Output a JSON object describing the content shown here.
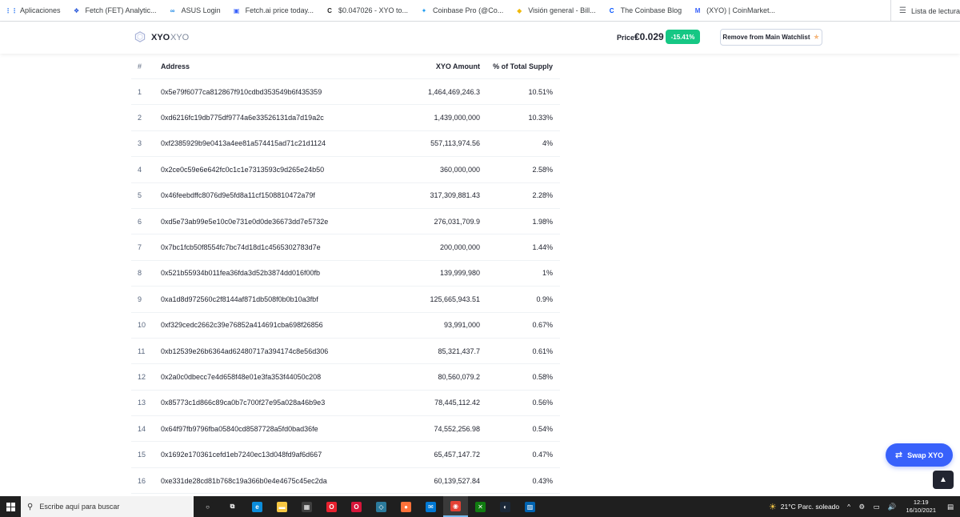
{
  "bookmarks": [
    {
      "label": "Aplicaciones",
      "icon": "apps-grid-icon",
      "color": "#4285f4"
    },
    {
      "label": "Fetch (FET) Analytic...",
      "icon": "fetch-icon",
      "color": "#1d4ed8"
    },
    {
      "label": "ASUS Login",
      "icon": "asus-icon",
      "color": "#1e88e5"
    },
    {
      "label": "Fetch.ai price today...",
      "icon": "coingecko-icon",
      "color": "#3861fb"
    },
    {
      "label": "$0.047026 - XYO to...",
      "icon": "c-icon",
      "color": "#222222"
    },
    {
      "label": "Coinbase Pro (@Co...",
      "icon": "twitter-icon",
      "color": "#1d9bf0"
    },
    {
      "label": "Visión general - Bill...",
      "icon": "binance-icon",
      "color": "#f0b90b"
    },
    {
      "label": "The Coinbase Blog",
      "icon": "coinbase-icon",
      "color": "#0052ff"
    },
    {
      "label": "(XYO) | CoinMarket...",
      "icon": "coinmarketcap-icon",
      "color": "#3861fb"
    }
  ],
  "reading_list": "Lista de lectura",
  "header": {
    "symbol": "XYO",
    "name": "XYO",
    "price_label": "Price:",
    "price_value": "€0.029",
    "change": "-15.41%",
    "watchlist_button": "Remove from Main Watchlist",
    "accent_green": "#16c784"
  },
  "table": {
    "columns": [
      "#",
      "Address",
      "XYO Amount",
      "% of Total Supply"
    ],
    "rows": [
      {
        "rank": "1",
        "address": "0x5e79f6077ca812867f910cdbd353549b6f435359",
        "amount": "1,464,469,246.3",
        "pct": "10.51%"
      },
      {
        "rank": "2",
        "address": "0xd6216fc19db775df9774a6e33526131da7d19a2c",
        "amount": "1,439,000,000",
        "pct": "10.33%"
      },
      {
        "rank": "3",
        "address": "0xf2385929b9e0413a4ee81a574415ad71c21d1124",
        "amount": "557,113,974.56",
        "pct": "4%"
      },
      {
        "rank": "4",
        "address": "0x2ce0c59e6e642fc0c1c1e7313593c9d265e24b50",
        "amount": "360,000,000",
        "pct": "2.58%"
      },
      {
        "rank": "5",
        "address": "0x46feebdffc8076d9e5fd8a11cf1508810472a79f",
        "amount": "317,309,881.43",
        "pct": "2.28%"
      },
      {
        "rank": "6",
        "address": "0xd5e73ab99e5e10c0e731e0d0de36673dd7e5732e",
        "amount": "276,031,709.9",
        "pct": "1.98%"
      },
      {
        "rank": "7",
        "address": "0x7bc1fcb50f8554fc7bc74d18d1c4565302783d7e",
        "amount": "200,000,000",
        "pct": "1.44%"
      },
      {
        "rank": "8",
        "address": "0x521b55934b011fea36fda3d52b3874dd016f00fb",
        "amount": "139,999,980",
        "pct": "1%"
      },
      {
        "rank": "9",
        "address": "0xa1d8d972560c2f8144af871db508f0b0b10a3fbf",
        "amount": "125,665,943.51",
        "pct": "0.9%"
      },
      {
        "rank": "10",
        "address": "0xf329cedc2662c39e76852a414691cba698f26856",
        "amount": "93,991,000",
        "pct": "0.67%"
      },
      {
        "rank": "11",
        "address": "0xb12539e26b6364ad62480717a394174c8e56d306",
        "amount": "85,321,437.7",
        "pct": "0.61%"
      },
      {
        "rank": "12",
        "address": "0x2a0c0dbecc7e4d658f48e01e3fa353f44050c208",
        "amount": "80,560,079.2",
        "pct": "0.58%"
      },
      {
        "rank": "13",
        "address": "0x85773c1d866c89ca0b7c700f27e95a028a46b9e3",
        "amount": "78,445,112.42",
        "pct": "0.56%"
      },
      {
        "rank": "14",
        "address": "0x64f97fb9796fba05840cd8587728a5fd0bad36fe",
        "amount": "74,552,256.98",
        "pct": "0.54%"
      },
      {
        "rank": "15",
        "address": "0x1692e170361cefd1eb7240ec13d048fd9af6d667",
        "amount": "65,457,147.72",
        "pct": "0.47%"
      },
      {
        "rank": "16",
        "address": "0xe331de28cd81b768c19a366b0e4e4675c45ec2da",
        "amount": "60,139,527.84",
        "pct": "0.43%"
      }
    ]
  },
  "swap_button": "Swap XYO",
  "taskbar": {
    "search_placeholder": "Escribe aquí para buscar",
    "weather": "21°C  Parc. soleado",
    "time": "12:19",
    "date": "16/10/2021",
    "apps": [
      {
        "icon": "cortana-icon",
        "color": "#1f1f1f"
      },
      {
        "icon": "task-view-icon",
        "color": "#1f1f1f"
      },
      {
        "icon": "edge-icon",
        "color": "#0c8ddb"
      },
      {
        "icon": "file-explorer-icon",
        "color": "#f8c843"
      },
      {
        "icon": "store-icon",
        "color": "#3f3f3f"
      },
      {
        "icon": "opera-icon",
        "color": "#e8212e"
      },
      {
        "icon": "opera-gx-icon",
        "color": "#d7153a"
      },
      {
        "icon": "app-icon",
        "color": "#2b7a9c"
      },
      {
        "icon": "firefox-icon",
        "color": "#ff7139"
      },
      {
        "icon": "mail-icon",
        "color": "#0078d4"
      },
      {
        "icon": "chrome-icon",
        "color": "#e44134"
      },
      {
        "icon": "xbox-icon",
        "color": "#107c10"
      },
      {
        "icon": "steam-icon",
        "color": "#1b2838"
      },
      {
        "icon": "photos-icon",
        "color": "#0063b1"
      }
    ]
  }
}
